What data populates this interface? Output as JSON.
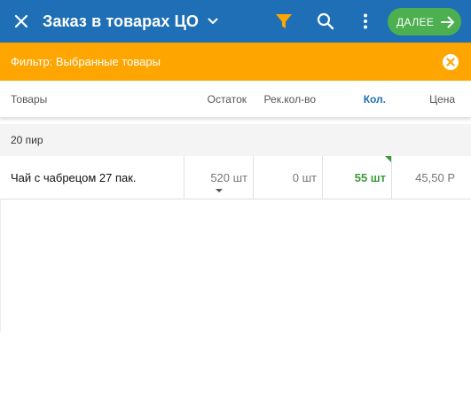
{
  "appbar": {
    "title": "Заказ в товарах ЦО",
    "next_label": "ДАЛЕЕ",
    "icons": {
      "close": "close-icon",
      "caret": "chevron-down-icon",
      "filter": "filter-icon",
      "search": "search-icon",
      "menu": "more-vert-icon",
      "next": "arrow-right-icon"
    },
    "colors": {
      "background": "#1e6fb5",
      "filter_icon": "#ffa500",
      "next_button": "#4caf50"
    }
  },
  "filter_bar": {
    "text": "Фильтр: Выбранные товары",
    "clear_icon": "clear-filter-icon",
    "color": "#ffa500"
  },
  "table": {
    "headers": {
      "goods": "Товары",
      "stock": "Остаток",
      "recommended": "Рек.кол-во",
      "quantity": "Кол.",
      "price": "Цена"
    },
    "groups": [
      {
        "name": "20 пир",
        "rows": [
          {
            "name": "Чай с чабрецом 27 пак.",
            "stock": "520 шт",
            "recommended": "0 шт",
            "quantity": "55 шт",
            "price": "45,50 Р"
          }
        ]
      }
    ],
    "colors": {
      "quantity_header": "#1e6fb5",
      "quantity_value": "#3c9a3c"
    }
  }
}
